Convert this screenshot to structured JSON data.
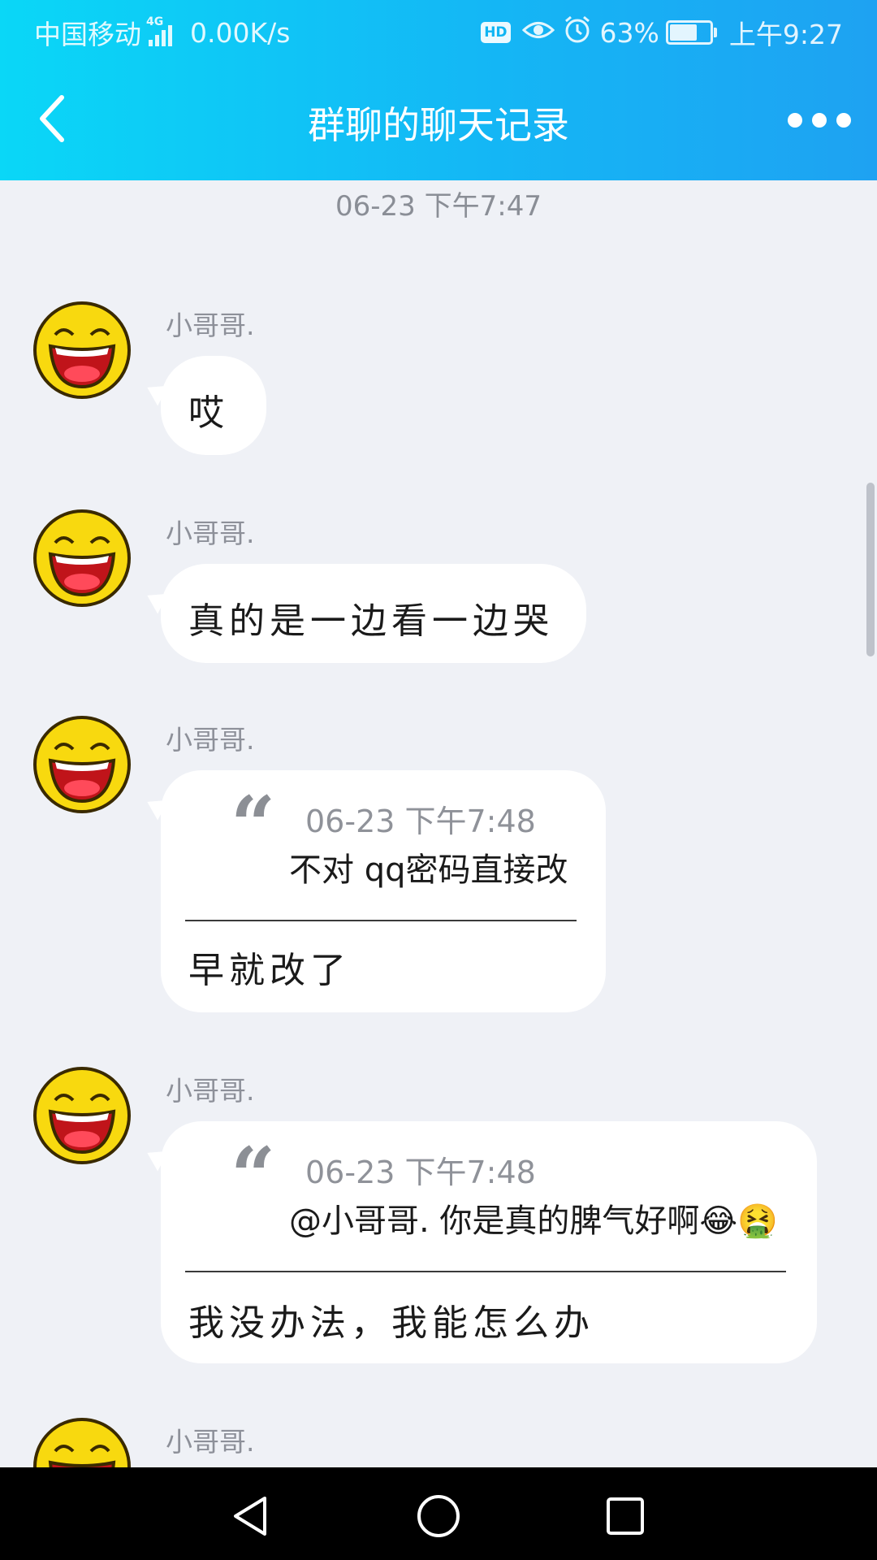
{
  "status_bar": {
    "carrier": "中国移动",
    "network": "4G",
    "speed": "0.00K/s",
    "hd": "HD",
    "battery": "63%",
    "time": "上午9:27"
  },
  "header": {
    "title": "群聊的聊天记录"
  },
  "timestamp": "06-23 下午7:47",
  "messages": [
    {
      "sender": "小哥哥.",
      "text": "哎"
    },
    {
      "sender": "小哥哥.",
      "text": "真的是一边看一边哭"
    },
    {
      "sender": "小哥哥.",
      "quote_time": "06-23 下午7:48",
      "quote_text": "不对 qq密码直接改",
      "text": "早就改了"
    },
    {
      "sender": "小哥哥.",
      "quote_time": "06-23 下午7:48",
      "quote_text": "@小哥哥. 你是真的脾气好啊😂🤮",
      "text": "我没办法，我能怎么办"
    },
    {
      "sender": "小哥哥."
    }
  ],
  "nav": {
    "back": "back-icon",
    "home": "home-icon",
    "recents": "recents-icon"
  }
}
